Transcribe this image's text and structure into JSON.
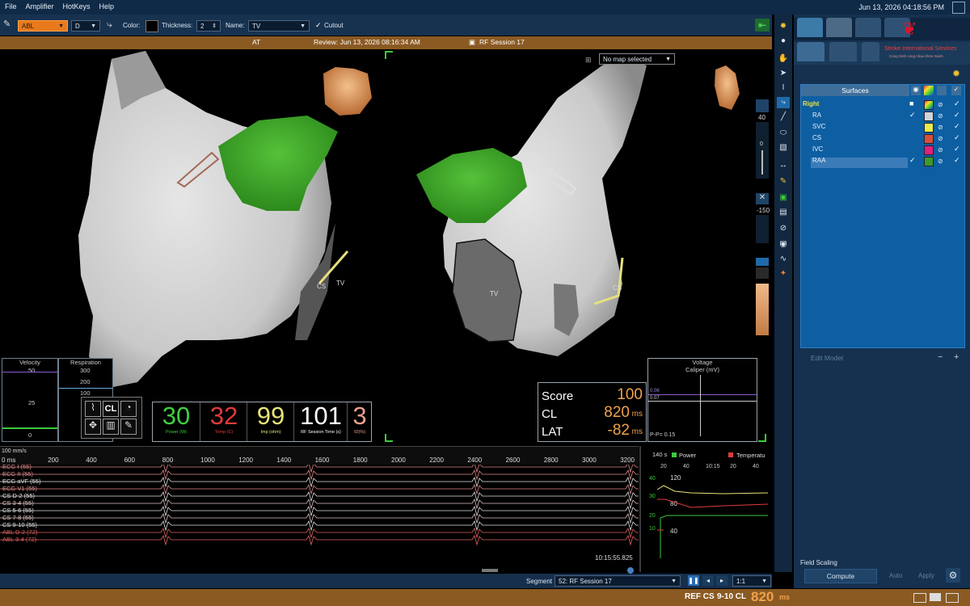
{
  "menu": {
    "items": [
      "File",
      "Amplifier",
      "HotKeys",
      "Help"
    ],
    "datetime": "Jun 13, 2026 04:18:56 PM"
  },
  "toolbar": {
    "catheter": "ABL",
    "electrode": "D",
    "color_label": "Color:",
    "thickness_label": "Thickness:",
    "thickness_value": "2",
    "name_label": "Name:",
    "name_value": "TV",
    "cutout_label": "Cutout"
  },
  "review_bar": {
    "left": "AT",
    "center": "Review: Jun 13, 2026 08:16:34 AM",
    "right": "RF Session 17"
  },
  "viewport": {
    "map_select": "No map selected",
    "left_labels": {
      "cs": "CS",
      "tv": "TV"
    },
    "right_labels": {
      "tv": "TV",
      "cs": "CS"
    },
    "slider_top_value": "40",
    "slider_zero": "0",
    "slider_low_value": "-150"
  },
  "velocity": {
    "title": "Velocity",
    "ticks": [
      "50",
      "25",
      "0"
    ]
  },
  "respiration": {
    "title": "Respiration",
    "ticks": [
      "300",
      "200",
      "100"
    ]
  },
  "stats": [
    {
      "value": "30",
      "unit": "Power (W)",
      "color": "#3fcf3f"
    },
    {
      "value": "32",
      "unit": "Temp (C)",
      "color": "#e23a3a"
    },
    {
      "value": "99",
      "unit": "Imp (ohm)",
      "color": "#e9e27a"
    },
    {
      "value": "101",
      "unit": "RF Session Time (s)",
      "color": "#ffffff"
    },
    {
      "value": "3",
      "unit": "ID(%)",
      "color": "#e9a090"
    }
  ],
  "score": {
    "score_label": "Score",
    "score_value": "100",
    "cl_label": "CL",
    "cl_value": "820",
    "cl_unit": "ms",
    "lat_label": "LAT",
    "lat_value": "-82",
    "lat_unit": "ms"
  },
  "voltage": {
    "title": "Voltage",
    "subtitle": "Caliper (mV)",
    "pp": "P-P= 0.15",
    "v1": "0.06",
    "v2": "0.07"
  },
  "ecg": {
    "scale": "100 mm/s",
    "ruler_ticks": [
      "0 ms",
      "200",
      "400",
      "600",
      "800",
      "1000",
      "1200",
      "1400",
      "1600",
      "1800",
      "2000",
      "2200",
      "2400",
      "2600",
      "2800",
      "3000",
      "3200"
    ],
    "channels": [
      "ECG I (55)",
      "ECG II (55)",
      "ECG aVF (55)",
      "ECG V1 (55)",
      "CS  D-2 (55)",
      "CS  3-4 (55)",
      "CS  5-6 (55)",
      "CS  7-8 (55)",
      "CS  9-10 (55)",
      "ABL  D-2 (72)",
      "ABL  3-4 (72)"
    ],
    "timestamp": "10:15:55.825"
  },
  "trend": {
    "window": "140 s",
    "power_label": "Power",
    "temp_label": "Temperatu",
    "x_ticks": [
      "20",
      "40",
      "10:15",
      "20",
      "40"
    ],
    "left_ticks": [
      "40",
      "30",
      "20",
      "10"
    ],
    "right_ticks": [
      "120",
      "80",
      "40"
    ]
  },
  "segment": {
    "label": "Segment",
    "value": "52: RF Session 17",
    "ratio": "1:1"
  },
  "surfaces": {
    "header": "Surfaces",
    "group": "Right",
    "items": [
      {
        "name": "RA",
        "color": "#d0d4d8",
        "visible": true
      },
      {
        "name": "SVC",
        "color": "#ecec4a",
        "visible": false
      },
      {
        "name": "CS",
        "color": "#d8503a",
        "visible": false
      },
      {
        "name": "IVC",
        "color": "#e0207a",
        "visible": false
      },
      {
        "name": "RAA",
        "color": "#3a9a2a",
        "visible": true
      }
    ]
  },
  "brand": {
    "name": "Stroke International Services",
    "tagline": "Cùng Sinh cùng nhau khỏe mạnh"
  },
  "right_panel": {
    "edit_model": "Edit Model",
    "field_scaling": "Field Scaling",
    "compute": "Compute",
    "auto": "Auto",
    "apply": "Apply"
  },
  "footer": {
    "ref": "REF CS",
    "channels": "9-10 CL",
    "cl_value": "820",
    "unit": "ms"
  }
}
